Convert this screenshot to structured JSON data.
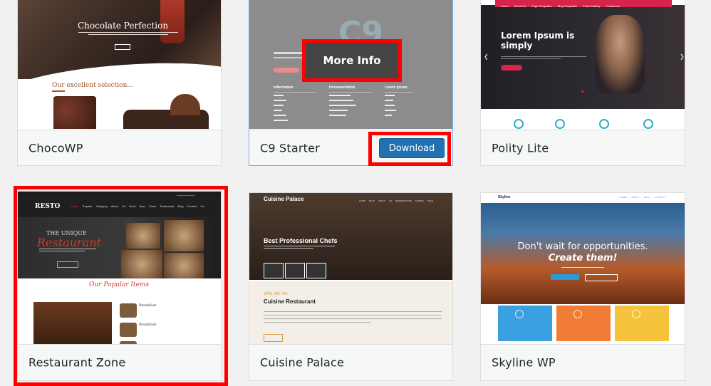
{
  "themes": [
    {
      "name": "ChocoWP"
    },
    {
      "name": "C9 Starter",
      "more_info": "More Info",
      "download": "Download"
    },
    {
      "name": "Polity Lite"
    },
    {
      "name": "Restaurant Zone"
    },
    {
      "name": "Cuisine Palace"
    },
    {
      "name": "Skyline WP"
    }
  ],
  "previews": {
    "choco": {
      "title": "Chocolate Perfection",
      "selection": "Our excellent selection..."
    },
    "polity": {
      "title": "Lorem Ipsum is simply",
      "nav": [
        "Home",
        "About Us",
        "Page Templates",
        "Blog Templates",
        "Photo Gallery",
        "Contact Us"
      ]
    },
    "resto": {
      "logo": "RESTO",
      "tag": "THE UNIQUE",
      "title": "Restaurant",
      "popular": "Our Popular Items",
      "item": "Breakfast",
      "menu": [
        "Home",
        "Popular",
        "Category",
        "About Us",
        "Book Now",
        "Chefs",
        "Testimonial",
        "Blog",
        "Contact Us"
      ]
    },
    "cuisine": {
      "logo": "Cuisine Palace",
      "hero": "Best Professional Chefs",
      "script": "Who We Are",
      "section": "Cuisine Restaurant",
      "nav": [
        "HOME",
        "BLOG",
        "ABOUT US",
        "RESERVATIONS",
        "SAMPLE PAGE"
      ]
    },
    "skyline": {
      "logo": "Skyline",
      "line1": "Don't wait for opportunities.",
      "line2": "Create them!",
      "nav": [
        "HOME",
        "ABOUT",
        "BLOG",
        "CONTACT"
      ]
    }
  },
  "colors": {
    "highlight": "#ff0000",
    "download_bg": "#2271b1",
    "card_border": "#dcdcde",
    "label_bg": "#f6f7f7"
  }
}
